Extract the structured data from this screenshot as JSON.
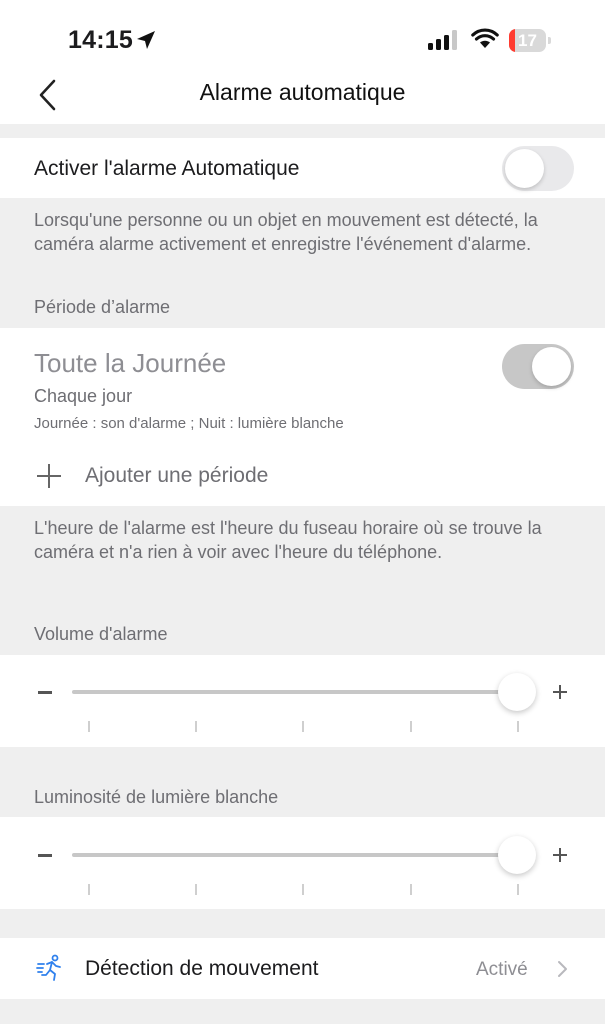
{
  "status_bar": {
    "time": "14:15",
    "battery_level": "17",
    "battery_fraction": 0.17,
    "icons": [
      "location-arrow-icon",
      "cellular-signal-icon",
      "wifi-icon",
      "battery-icon"
    ]
  },
  "nav": {
    "title": "Alarme automatique",
    "back_icon": "chevron-left-icon"
  },
  "auto_alarm": {
    "label": "Activer l'alarme Automatique",
    "enabled": false,
    "description": "Lorsqu'une personne ou un objet en mouvement est détecté, la caméra alarme activement et enregistre l'événement d'alarme."
  },
  "period": {
    "header": "Période d’alarme",
    "item": {
      "title": "Toute la Journée",
      "repeat": "Chaque jour",
      "detail": "Journée : son d'alarme ; Nuit : lumière blanche",
      "enabled": true
    },
    "add_label": "Ajouter une période",
    "timezone_note": "L'heure de l'alarme est l'heure du fuseau horaire où se trouve la caméra et n'a rien à voir avec l'heure du téléphone."
  },
  "volume": {
    "header": "Volume d'alarme",
    "value_fraction": 1.0
  },
  "brightness": {
    "header": "Luminosité de lumière blanche",
    "value_fraction": 1.0
  },
  "motion_detection": {
    "label": "Détection de mouvement",
    "value": "Activé",
    "icon": "running-person-icon",
    "accent": "#2f80ed"
  },
  "colors": {
    "toggle_off": "#e9e9eb",
    "toggle_on_disabled": "#c7c7c7",
    "background": "#efefef"
  }
}
